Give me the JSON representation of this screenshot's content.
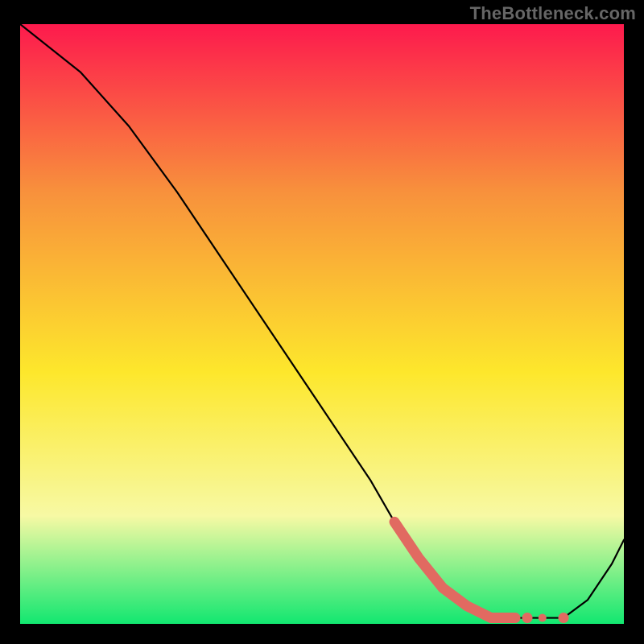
{
  "watermark": "TheBottleneck.com",
  "colors": {
    "background": "#000000",
    "gradient_top": "#fd1a4d",
    "gradient_mid1": "#f8913c",
    "gradient_mid2": "#fde72c",
    "gradient_mid3": "#f7f9a4",
    "gradient_bottom": "#12e770",
    "curve": "#000000",
    "highlight": "#e16a61"
  },
  "chart_data": {
    "type": "line",
    "title": "",
    "xlabel": "",
    "ylabel": "",
    "xlim": [
      0,
      100
    ],
    "ylim": [
      0,
      100
    ],
    "series": [
      {
        "name": "curve",
        "x": [
          0,
          10,
          18,
          26,
          34,
          42,
          50,
          58,
          62,
          66,
          70,
          74,
          78,
          82,
          86,
          90,
          94,
          98,
          100
        ],
        "y": [
          100,
          92,
          83,
          72,
          60,
          48,
          36,
          24,
          17,
          11,
          6,
          3,
          1,
          1,
          1,
          1,
          4,
          10,
          14
        ]
      }
    ],
    "highlight_range": {
      "x_start": 62,
      "x_end": 82
    }
  }
}
